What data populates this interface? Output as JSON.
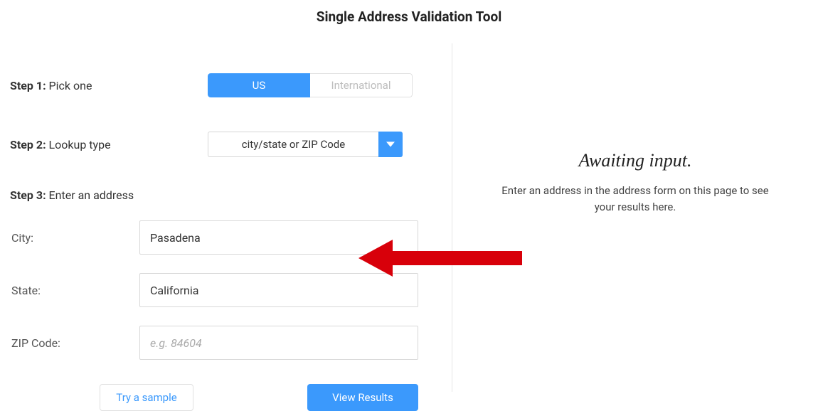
{
  "title": "Single Address Validation Tool",
  "step1": {
    "label_prefix": "Step 1:",
    "label_text": " Pick one",
    "options": {
      "us": "US",
      "intl": "International"
    },
    "active": "us"
  },
  "step2": {
    "label_prefix": "Step 2:",
    "label_text": " Lookup type",
    "selected": "city/state or ZIP Code"
  },
  "step3": {
    "label_prefix": "Step 3:",
    "label_text": " Enter an address",
    "city_label": "City:",
    "city_value": "Pasadena",
    "state_label": "State:",
    "state_value": "California",
    "zip_label": "ZIP Code:",
    "zip_value": "",
    "zip_placeholder": "e.g. 84604"
  },
  "buttons": {
    "sample": "Try a sample",
    "view": "View Results"
  },
  "results": {
    "heading": "Awaiting input.",
    "subtext": "Enter an address in the address form on this page to see your results here."
  },
  "colors": {
    "accent": "#3b99fc",
    "arrow": "#d8000a"
  }
}
